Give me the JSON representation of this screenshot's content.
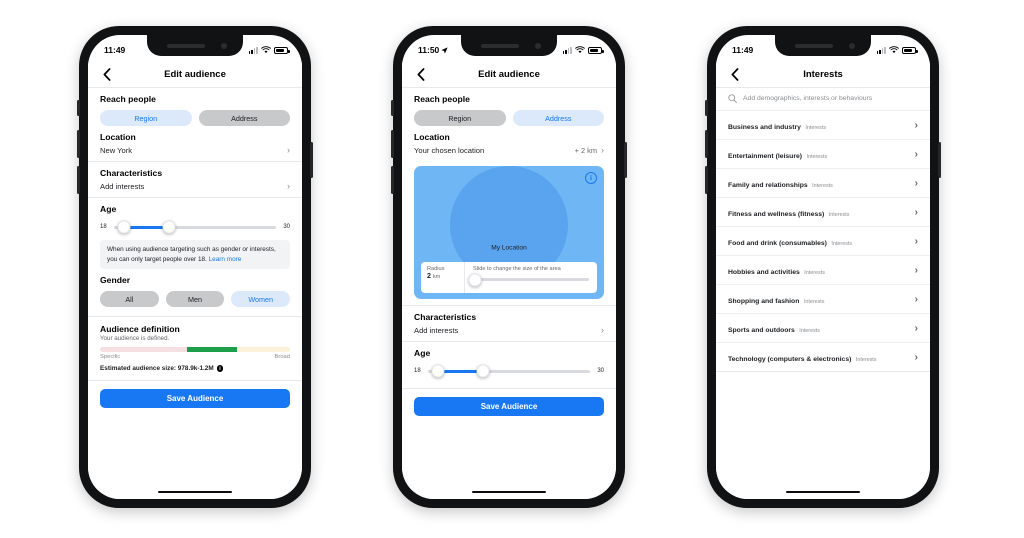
{
  "phones": [
    {
      "status": {
        "time": "11:49",
        "has_location_arrow": false,
        "wifi": "wifi-icon",
        "battery": "battery-icon"
      },
      "nav": {
        "back": "chevron-left-icon",
        "title": "Edit audience"
      },
      "reach": {
        "title": "Reach people",
        "options": [
          {
            "label": "Region",
            "selected": true
          },
          {
            "label": "Address",
            "selected": false
          }
        ]
      },
      "location": {
        "title": "Location",
        "value": "New York",
        "chevron": "chevron-right-icon"
      },
      "characteristics": {
        "title": "Characteristics",
        "value": "Add interests",
        "chevron": "chevron-right-icon"
      },
      "age": {
        "title": "Age",
        "min": "18",
        "max": "30"
      },
      "notice": {
        "text": "When using audience targeting such as gender or interests, you can only target people over 18.",
        "link": "Learn more"
      },
      "gender": {
        "title": "Gender",
        "options": [
          {
            "label": "All",
            "selected": false
          },
          {
            "label": "Men",
            "selected": false
          },
          {
            "label": "Women",
            "selected": true
          }
        ]
      },
      "audience_definition": {
        "title": "Audience definition",
        "subtitle": "Your audience is defined.",
        "scale_left": "Specific",
        "scale_right": "Broad",
        "estimate_label": "Estimated audience size: 978.9k-1.2M",
        "info_icon": "info-icon"
      },
      "save": {
        "label": "Save Audience"
      }
    },
    {
      "status": {
        "time": "11:50",
        "has_location_arrow": true,
        "wifi": "wifi-icon",
        "battery": "battery-icon"
      },
      "nav": {
        "back": "chevron-left-icon",
        "title": "Edit audience"
      },
      "reach": {
        "title": "Reach people",
        "options": [
          {
            "label": "Region",
            "selected": false
          },
          {
            "label": "Address",
            "selected": true
          }
        ]
      },
      "location": {
        "title": "Location",
        "value": "Your chosen location",
        "distance": "+ 2 km",
        "chevron": "chevron-right-icon"
      },
      "map": {
        "label": "My Location",
        "info_icon": "info-icon",
        "radius_label": "Radius",
        "radius_value": "2",
        "radius_unit": "km",
        "slider_hint": "Slide to change the size of the area"
      },
      "characteristics": {
        "title": "Characteristics",
        "value": "Add interests",
        "chevron": "chevron-right-icon"
      },
      "age": {
        "title": "Age",
        "min": "18",
        "max": "30"
      },
      "save": {
        "label": "Save Audience"
      }
    },
    {
      "status": {
        "time": "11:49",
        "has_location_arrow": false,
        "wifi": "wifi-icon",
        "battery": "battery-icon"
      },
      "nav": {
        "back": "chevron-left-icon",
        "title": "Interests"
      },
      "search": {
        "icon": "search-icon",
        "placeholder": "Add demographics, interests or behaviours",
        "value": ""
      },
      "interests": [
        {
          "name": "Business and industry",
          "category": "Interests"
        },
        {
          "name": "Entertainment (leisure)",
          "category": "Interests"
        },
        {
          "name": "Family and relationships",
          "category": "Interests"
        },
        {
          "name": "Fitness and wellness (fitness)",
          "category": "Interests"
        },
        {
          "name": "Food and drink (consumables)",
          "category": "Interests"
        },
        {
          "name": "Hobbies and activities",
          "category": "Interests"
        },
        {
          "name": "Shopping and fashion",
          "category": "Interests"
        },
        {
          "name": "Sports and outdoors",
          "category": "Interests"
        },
        {
          "name": "Technology (computers & electronics)",
          "category": "Interests"
        }
      ]
    }
  ],
  "colors": {
    "accent": "#1877f2",
    "selected_pill_bg": "#dbe9fb",
    "unselected_pill_bg": "#c8c9cb",
    "map_bg": "#6fb6f5",
    "map_circle": "#5aa3ef",
    "green": "#1d9e4b",
    "pink": "#f6dfe0",
    "yellow": "#fbf0da"
  }
}
